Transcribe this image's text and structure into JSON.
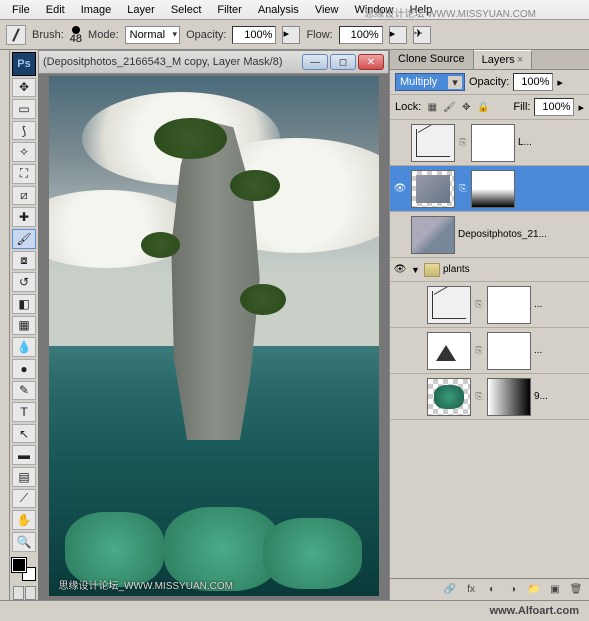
{
  "menu": [
    "File",
    "Edit",
    "Image",
    "Layer",
    "Select",
    "Filter",
    "Analysis",
    "View",
    "Window",
    "Help"
  ],
  "watermark_top": "思缘设计论坛 WWW.MISSYUAN.COM",
  "optbar": {
    "brush_label": "Brush:",
    "brush_size": "48",
    "mode_label": "Mode:",
    "mode_value": "Normal",
    "opacity_label": "Opacity:",
    "opacity_value": "100%",
    "flow_label": "Flow:",
    "flow_value": "100%"
  },
  "doc_title": "(Depositphotos_2166543_M copy, Layer Mask/8)",
  "ps_badge": "Ps",
  "panels": {
    "tabs": [
      "Clone Source",
      "Layers"
    ],
    "active_tab": 1,
    "blend_mode": "Multiply",
    "opacity_label": "Opacity:",
    "opacity_value": "100%",
    "lock_label": "Lock:",
    "fill_label": "Fill:",
    "fill_value": "100%"
  },
  "layers": [
    {
      "visible": false,
      "type": "curves",
      "mask": true,
      "name": "L...",
      "selected": false
    },
    {
      "visible": true,
      "type": "rock",
      "mask": "grad",
      "name": "",
      "selected": true
    },
    {
      "visible": false,
      "type": "rock2",
      "mask": false,
      "name": "Depositphotos_21...",
      "selected": false
    },
    {
      "visible": true,
      "type": "group",
      "name": "plants",
      "expanded": true
    },
    {
      "visible": false,
      "type": "curves",
      "mask": true,
      "name": "...",
      "selected": false
    },
    {
      "visible": false,
      "type": "levels",
      "mask": true,
      "name": "...",
      "selected": false
    },
    {
      "visible": false,
      "type": "coral",
      "mask": "grad2",
      "name": "9...",
      "selected": false
    }
  ],
  "footer_link": "www.Alfoart.com",
  "watermark_bottom": "思缘设计论坛_WWW.MISSYUAN.COM"
}
